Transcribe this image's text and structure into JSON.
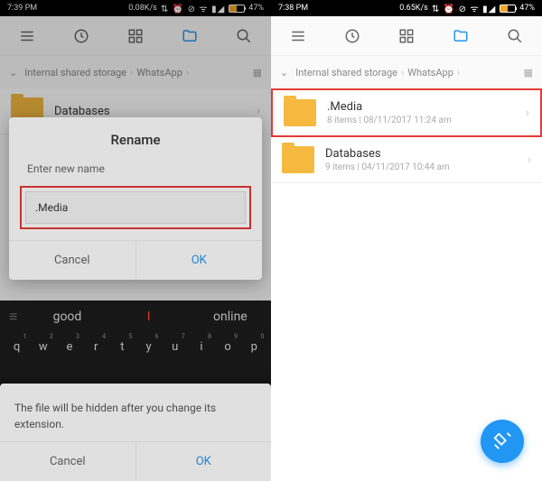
{
  "left": {
    "status": {
      "time": "7:39 PM",
      "speed": "0.08K/s",
      "battery": "47%"
    },
    "breadcrumb": {
      "path1": "Internal shared storage",
      "path2": "WhatsApp"
    },
    "folder": {
      "name": "Databases"
    },
    "dialog": {
      "title": "Rename",
      "label": "Enter new name",
      "input_value": ".Media",
      "cancel": "Cancel",
      "ok": "OK"
    },
    "suggestions": {
      "s1": "good",
      "s2": "I",
      "s3": "online"
    },
    "keys": {
      "q": "q",
      "w": "w",
      "e": "e",
      "r": "r",
      "t": "t",
      "y": "y",
      "u": "u",
      "i": "i",
      "o": "o",
      "p": "p"
    },
    "hidden_dialog": {
      "text": "The file will be hidden after you change its extension.",
      "cancel": "Cancel",
      "ok": "OK"
    }
  },
  "right": {
    "status": {
      "time": "7:38 PM",
      "speed": "0.65K/s",
      "battery": "47%"
    },
    "breadcrumb": {
      "path1": "Internal shared storage",
      "path2": "WhatsApp"
    },
    "folders": [
      {
        "name": ".Media",
        "meta": "8 items | 08/11/2017 11:24 am"
      },
      {
        "name": "Databases",
        "meta": "9 items | 04/11/2017 10:44 am"
      }
    ]
  }
}
